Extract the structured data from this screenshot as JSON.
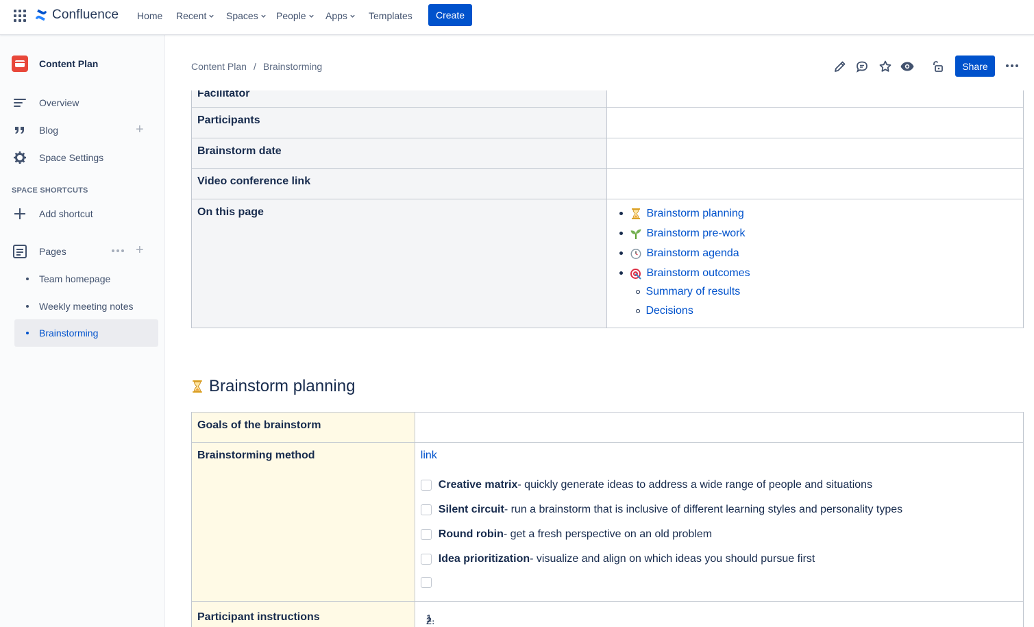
{
  "topnav": {
    "logo_text": "Confluence",
    "home": "Home",
    "recent": "Recent",
    "spaces": "Spaces",
    "people": "People",
    "apps": "Apps",
    "templates": "Templates",
    "create": "Create"
  },
  "sidebar": {
    "space_name": "Content Plan",
    "overview": "Overview",
    "blog": "Blog",
    "space_settings": "Space Settings",
    "shortcuts_heading": "SPACE SHORTCUTS",
    "add_shortcut": "Add shortcut",
    "pages": "Pages",
    "page_items": [
      "Team homepage",
      "Weekly meeting notes",
      "Brainstorming"
    ]
  },
  "header": {
    "breadcrumb": [
      "Content Plan",
      "Brainstorming"
    ],
    "breadcrumb_sep": "/",
    "share": "Share"
  },
  "info_table": {
    "partial_row_label": "Facilitator",
    "rows": [
      "Participants",
      "Brainstorm date",
      "Video conference link",
      "On this page"
    ],
    "toc": [
      "Brainstorm planning",
      "Brainstorm pre-work",
      "Brainstorm agenda",
      "Brainstorm outcomes"
    ],
    "toc_sub": [
      "Summary of results",
      "Decisions"
    ]
  },
  "planning": {
    "heading": "Brainstorm planning",
    "goals_label": "Goals of the brainstorm",
    "method_label": "Brainstorming method",
    "method_link": "link",
    "tasks": [
      {
        "bold": "Creative matrix",
        "rest": "- quickly generate ideas to address a wide range of people and situations"
      },
      {
        "bold": "Silent circuit",
        "rest": "- run a brainstorm that is inclusive of different learning styles and personality types"
      },
      {
        "bold": "Round robin",
        "rest": "- get a fresh perspective on an old problem"
      },
      {
        "bold": "Idea prioritization",
        "rest": "- visualize and align on which ideas you should pursue first"
      }
    ],
    "participant_label": "Participant instructions",
    "list_numbers": [
      "1.",
      "2."
    ]
  },
  "colors": {
    "brand_blue": "#0052cc",
    "header_cell": "#f4f5f7",
    "planning_header_cell": "#fffae6"
  }
}
